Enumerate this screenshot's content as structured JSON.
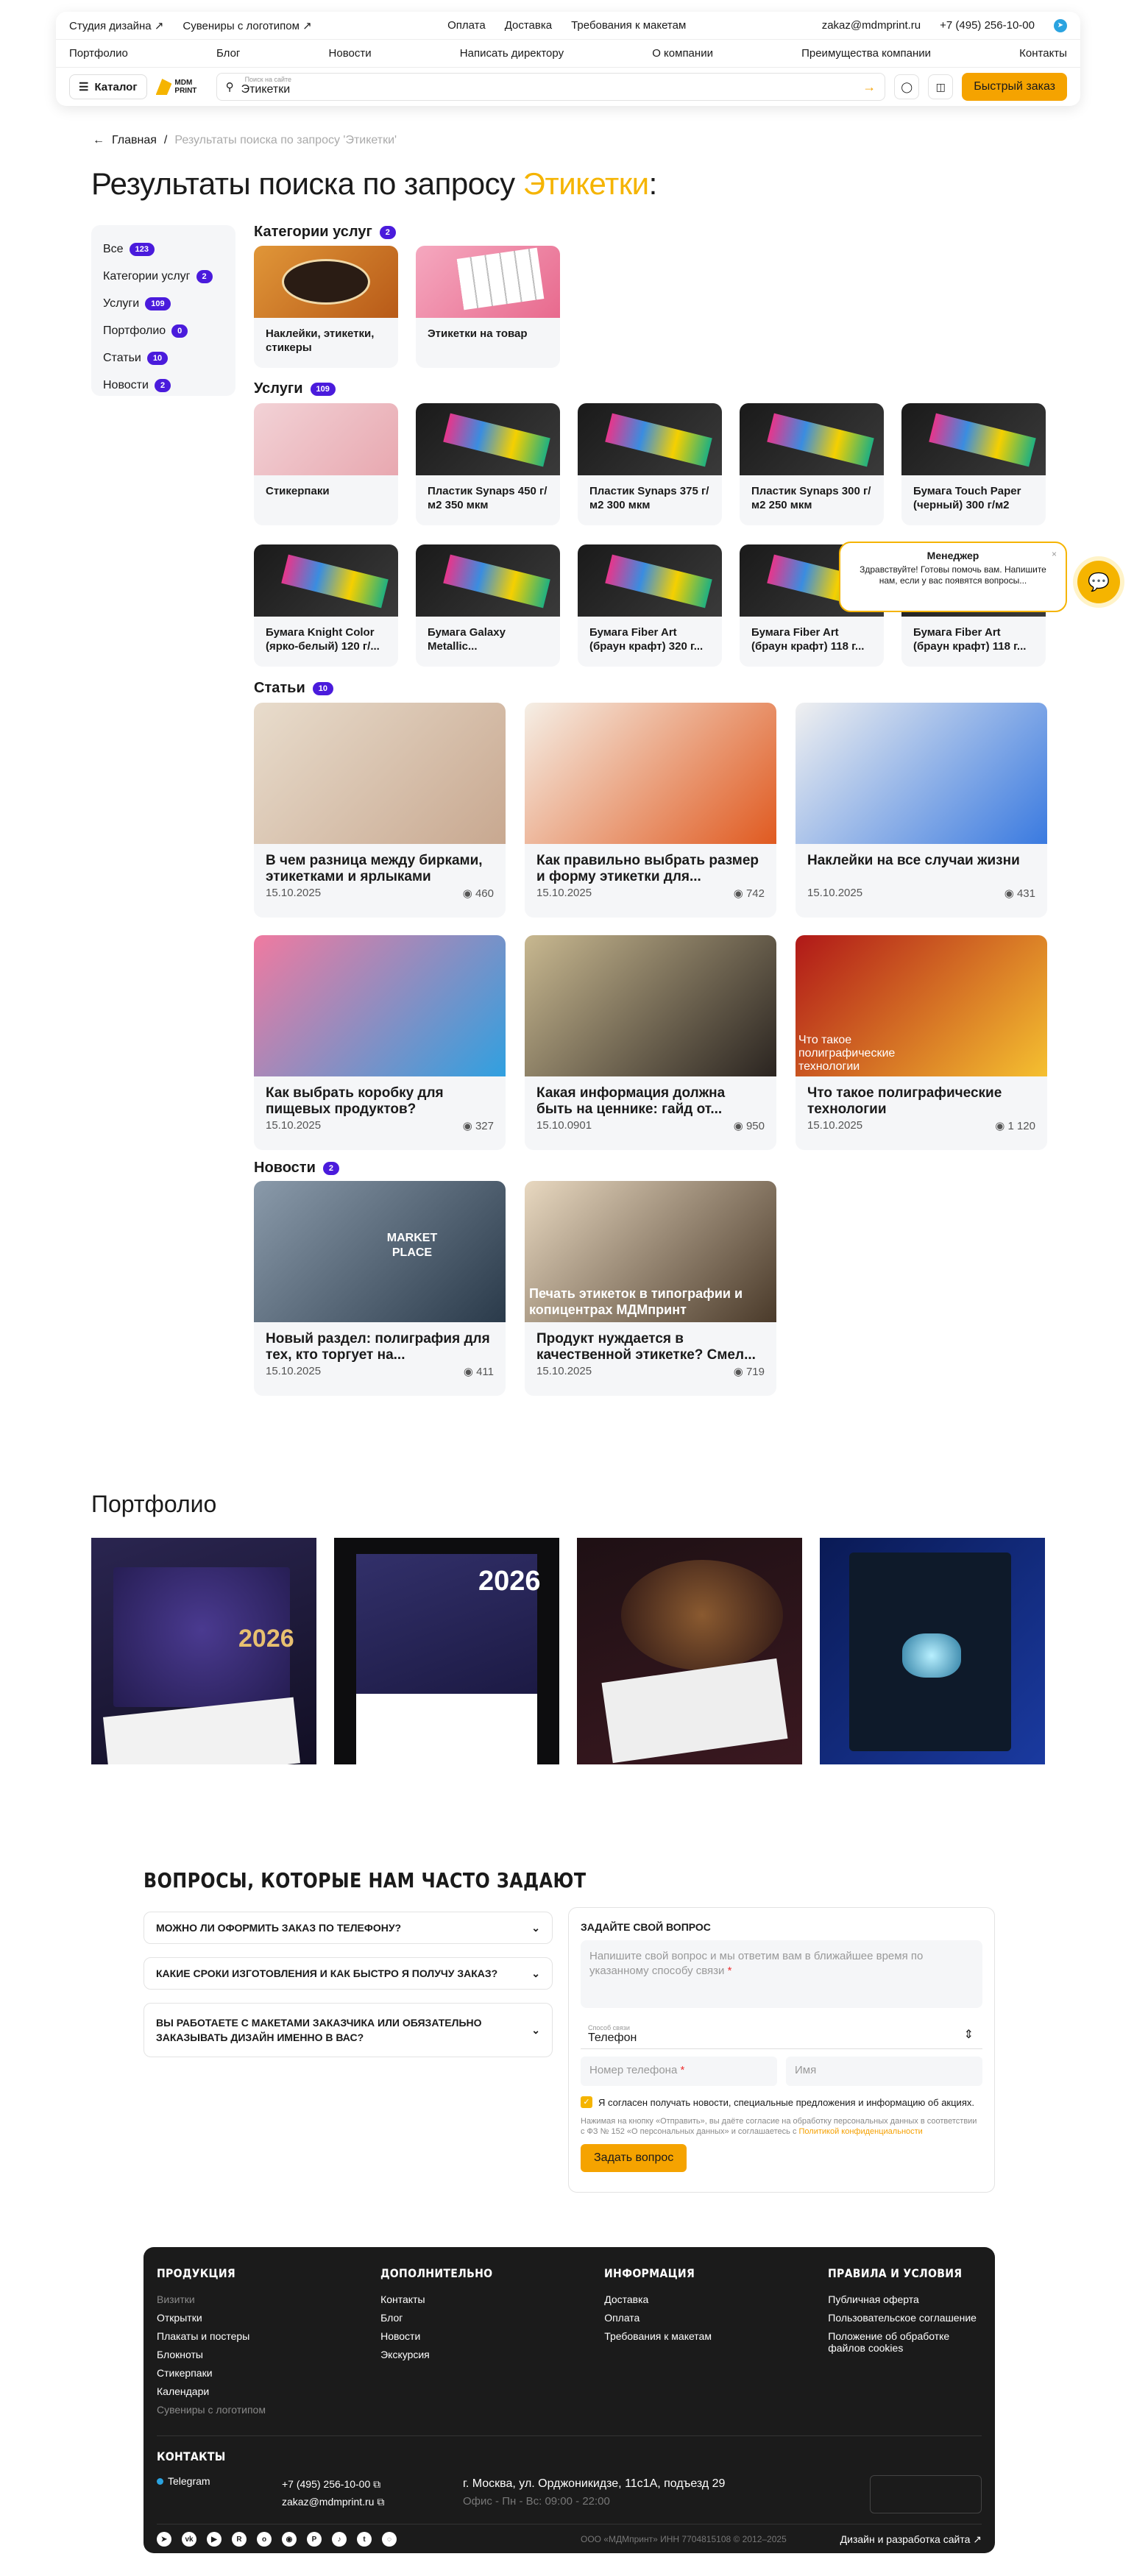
{
  "header": {
    "top_left": [
      "Студия дизайна ↗",
      "Сувениры с логотипом ↗"
    ],
    "top_center": [
      "Оплата",
      "Доставка",
      "Требования к макетам"
    ],
    "email": "zakaz@mdmprint.ru",
    "phone": "+7 (495) 256-10-00",
    "nav": [
      "Портфолио",
      "Блог",
      "Новости",
      "Написать директору",
      "О компании",
      "Преимущества компании",
      "Контакты"
    ],
    "catalog": "Каталог",
    "logo_text": "MDM PRINT",
    "search_placeholder": "Поиск на сайте",
    "search_value": "Этикетки",
    "quick_order": "Быстрый заказ"
  },
  "breadcrumb": {
    "home": "Главная",
    "current": "Результаты поиска по запросу 'Этикетки'"
  },
  "title": {
    "prefix": "Результаты поиска по запросу ",
    "query": "Этикетки",
    "suffix": ":"
  },
  "filters": [
    {
      "label": "Все",
      "count": "123"
    },
    {
      "label": "Категории услуг",
      "count": "2"
    },
    {
      "label": "Услуги",
      "count": "109"
    },
    {
      "label": "Портфолио",
      "count": "0"
    },
    {
      "label": "Статьи",
      "count": "10"
    },
    {
      "label": "Новости",
      "count": "2"
    }
  ],
  "categories": {
    "title": "Категории услуг",
    "count": "2",
    "items": [
      "Наклейки, этикетки, стикеры",
      "Этикетки на товар"
    ]
  },
  "services": {
    "title": "Услуги",
    "count": "109",
    "items": [
      "Стикерпаки",
      "Пластик Synaps 450 г/м2 350 мкм",
      "Пластик Synaps 375 г/м2 300 мкм",
      "Пластик Synaps 300 г/м2 250 мкм",
      "Бумага Touch Paper (черный) 300 г/м2",
      "Бумага Knight Color (ярко-белый) 120 г/...",
      "Бумага Galaxy Metallic...",
      "Бумага Fiber Art (браун крафт) 320 г...",
      "Бумага Fiber Art (браун крафт) 118 г...",
      "Бумага Fiber Art (браун крафт) 118 г..."
    ]
  },
  "articles": {
    "title": "Статьи",
    "count": "10",
    "items": [
      {
        "title": "В чем разница между бирками, этикетками и ярлыками",
        "date": "15.10.2025",
        "views": "460"
      },
      {
        "title": "Как правильно выбрать размер и форму этикетки для...",
        "date": "15.10.2025",
        "views": "742"
      },
      {
        "title": "Наклейки на все случаи жизни",
        "date": "15.10.2025",
        "views": "431"
      },
      {
        "title": "Как выбрать коробку для пищевых продуктов?",
        "date": "15.10.2025",
        "views": "327"
      },
      {
        "title": "Какая информация должна быть на ценнике: гайд от...",
        "date": "15.10.0901",
        "views": "950"
      },
      {
        "title": "Что такое полиграфические технологии",
        "date": "15.10.2025",
        "views": "1 120",
        "overlay": "Что такое полиграфические технологии"
      }
    ]
  },
  "news": {
    "title": "Новости",
    "count": "2",
    "items": [
      {
        "title": "Новый раздел: полиграфия для тех, кто торгует на...",
        "date": "15.10.2025",
        "views": "411",
        "overlay": "MARKET PLACE"
      },
      {
        "title": "Продукт нуждается в качественной этикетке? Смел...",
        "date": "15.10.2025",
        "views": "719",
        "overlay": "Печать этикеток в типографии и копицентрах МДМпринт"
      }
    ]
  },
  "portfolio": {
    "title": "Портфолио",
    "year": "2026"
  },
  "faq": {
    "title": "ВОПРОСЫ, КОТОРЫЕ НАМ ЧАСТО ЗАДАЮТ",
    "items": [
      "МОЖНО ЛИ ОФОРМИТЬ ЗАКАЗ ПО ТЕЛЕФОНУ?",
      "КАКИЕ СРОКИ ИЗГОТОВЛЕНИЯ И КАК БЫСТРО Я ПОЛУЧУ ЗАКАЗ?",
      "ВЫ РАБОТАЕТЕ С МАКЕТАМИ ЗАКАЗЧИКА ИЛИ ОБЯЗАТЕЛЬНО ЗАКАЗЫВАТЬ ДИЗАЙН ИМЕННО В ВАС?"
    ],
    "form_title": "ЗАДАЙТЕ СВОЙ ВОПРОС",
    "question_placeholder": "Напишите свой вопрос и мы ответим вам в ближайшее время по указанному способу связи",
    "contact_label": "Способ связи",
    "contact_value": "Телефон",
    "phone_placeholder": "Номер телефона",
    "name_placeholder": "Имя",
    "consent": "Я согласен получать новости, специальные предложения и информацию об акциях.",
    "legal": "Нажимая на кнопку «Отправить», вы даёте согласие на обработку персональных данных в соответствии с ФЗ № 152 «О персональных данных» и соглашаетесь с ",
    "legal_link": "Политикой конфиденциальности",
    "submit": "Задать вопрос"
  },
  "footer": {
    "cols": [
      {
        "title": "ПРОДУКЦИЯ",
        "items": [
          "Визитки",
          "Открытки",
          "Плакаты и постеры",
          "Блокноты",
          "Стикерпаки",
          "Календари",
          "Сувениры с логотипом"
        ]
      },
      {
        "title": "ДОПОЛНИТЕЛЬНО",
        "items": [
          "Контакты",
          "Блог",
          "Новости",
          "Экскурсия"
        ]
      },
      {
        "title": "ИНФОРМАЦИЯ",
        "items": [
          "Доставка",
          "Оплата",
          "Требования к макетам"
        ]
      },
      {
        "title": "ПРАВИЛА И УСЛОВИЯ",
        "items": [
          "Публичная оферта",
          "Пользовательское соглашение",
          "Положение об обработке файлов cookies"
        ]
      }
    ],
    "contacts_title": "КОНТАКТЫ",
    "telegram": "Telegram",
    "phone": "+7 (495) 256-10-00",
    "email": "zakaz@mdmprint.ru",
    "address": "г. Москва, ул. Орджоникидзе, 11с1А, подъезд 29",
    "hours": "Офис - Пн - Вс: 09:00 - 22:00",
    "legal": "ООО «МДМпринт»    ИНН 7704815108    © 2012–2025",
    "dev": "Дизайн и разработка сайта ↗"
  },
  "chat": {
    "title": "Менеджер",
    "text": "Здравствуйте! Готовы помочь вам. Напишите нам, если у вас появятся вопросы..."
  },
  "colors": {
    "accent": "#f5b400",
    "badge": "#4a1bdc",
    "footer": "#1b1b1b"
  }
}
